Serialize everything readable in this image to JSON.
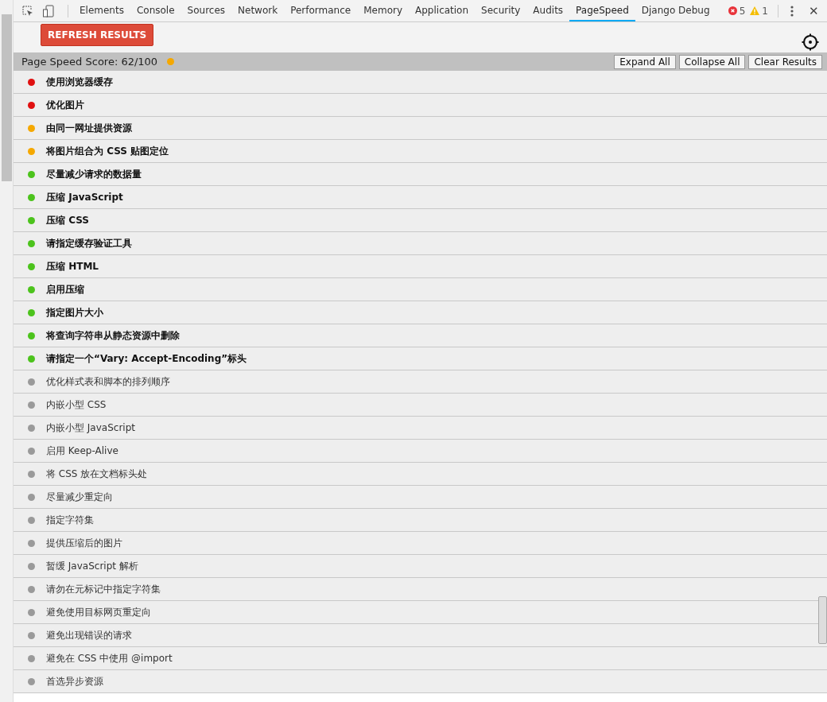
{
  "tabs": [
    {
      "label": "Elements",
      "selected": false
    },
    {
      "label": "Console",
      "selected": false
    },
    {
      "label": "Sources",
      "selected": false
    },
    {
      "label": "Network",
      "selected": false
    },
    {
      "label": "Performance",
      "selected": false
    },
    {
      "label": "Memory",
      "selected": false
    },
    {
      "label": "Application",
      "selected": false
    },
    {
      "label": "Security",
      "selected": false
    },
    {
      "label": "Audits",
      "selected": false
    },
    {
      "label": "PageSpeed",
      "selected": true
    },
    {
      "label": "Django Debug",
      "selected": false
    }
  ],
  "error_count": "5",
  "warning_count": "1",
  "close_glyph": "✕",
  "refresh_button": "REFRESH RESULTS",
  "score": {
    "label": "Page Speed Score: 62/100",
    "color": "#f5a800"
  },
  "actions": [
    "Expand All",
    "Collapse All",
    "Clear Results"
  ],
  "rules": [
    {
      "label": "使用浏览器缓存",
      "color": "#e01010",
      "bold": true
    },
    {
      "label": "优化图片",
      "color": "#e01010",
      "bold": true
    },
    {
      "label": "由同一网址提供资源",
      "color": "#f5a800",
      "bold": true
    },
    {
      "label": "将图片组合为 CSS 贴图定位",
      "color": "#f5a800",
      "bold": true
    },
    {
      "label": "尽量减少请求的数据量",
      "color": "#4cc31c",
      "bold": true
    },
    {
      "label": "压缩 JavaScript",
      "color": "#4cc31c",
      "bold": true
    },
    {
      "label": "压缩 CSS",
      "color": "#4cc31c",
      "bold": true
    },
    {
      "label": "请指定缓存验证工具",
      "color": "#4cc31c",
      "bold": true
    },
    {
      "label": "压缩 HTML",
      "color": "#4cc31c",
      "bold": true
    },
    {
      "label": "启用压缩",
      "color": "#4cc31c",
      "bold": true
    },
    {
      "label": "指定图片大小",
      "color": "#4cc31c",
      "bold": true
    },
    {
      "label": "将查询字符串从静态资源中删除",
      "color": "#4cc31c",
      "bold": true
    },
    {
      "label": "请指定一个“Vary: Accept-Encoding”标头",
      "color": "#4cc31c",
      "bold": true
    },
    {
      "label": "优化样式表和脚本的排列顺序",
      "color": "#9a9a9a",
      "bold": false
    },
    {
      "label": "内嵌小型 CSS",
      "color": "#9a9a9a",
      "bold": false
    },
    {
      "label": "内嵌小型 JavaScript",
      "color": "#9a9a9a",
      "bold": false
    },
    {
      "label": "启用 Keep-Alive",
      "color": "#9a9a9a",
      "bold": false
    },
    {
      "label": "将 CSS 放在文档标头处",
      "color": "#9a9a9a",
      "bold": false
    },
    {
      "label": "尽量减少重定向",
      "color": "#9a9a9a",
      "bold": false
    },
    {
      "label": "指定字符集",
      "color": "#9a9a9a",
      "bold": false
    },
    {
      "label": "提供压缩后的图片",
      "color": "#9a9a9a",
      "bold": false
    },
    {
      "label": "暂缓 JavaScript 解析",
      "color": "#9a9a9a",
      "bold": false
    },
    {
      "label": "请勿在元标记中指定字符集",
      "color": "#9a9a9a",
      "bold": false
    },
    {
      "label": "避免使用目标网页重定向",
      "color": "#9a9a9a",
      "bold": false
    },
    {
      "label": "避免出现错误的请求",
      "color": "#9a9a9a",
      "bold": false
    },
    {
      "label": "避免在 CSS 中使用 @import",
      "color": "#9a9a9a",
      "bold": false
    },
    {
      "label": "首选异步资源",
      "color": "#9a9a9a",
      "bold": false
    }
  ]
}
